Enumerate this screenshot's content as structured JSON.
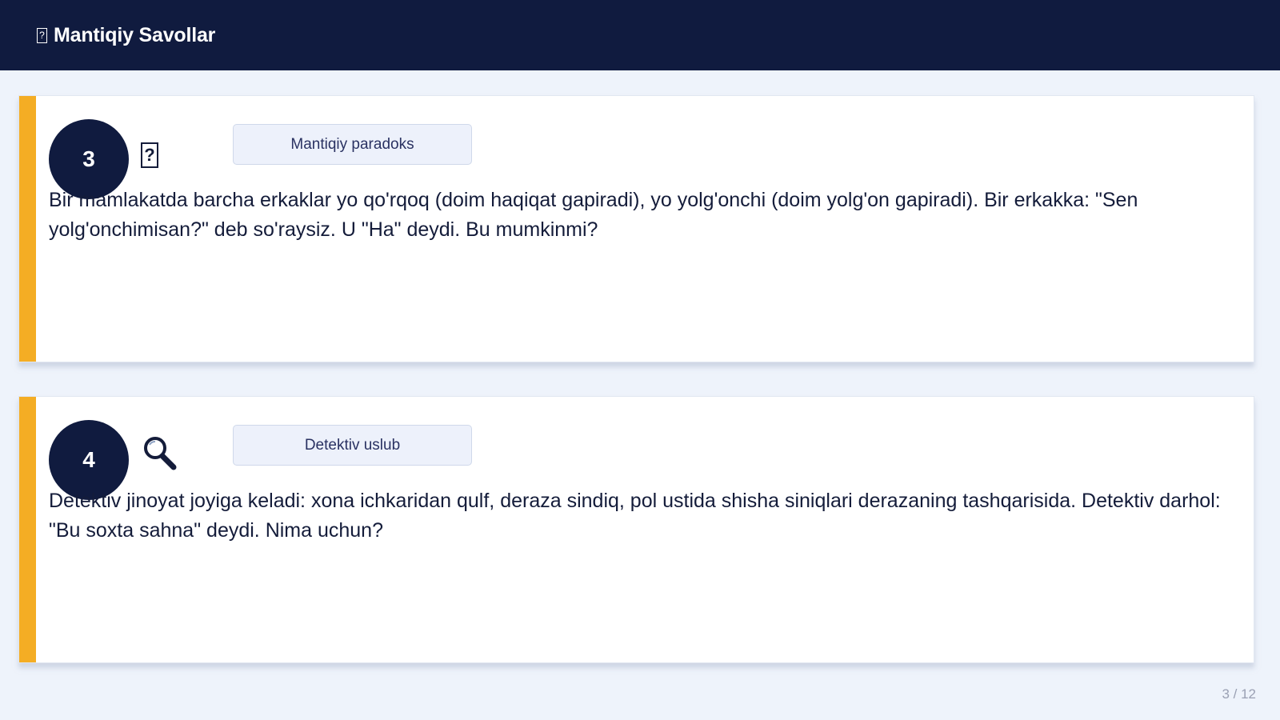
{
  "header": {
    "icon": "question-box-icon",
    "title": "Mantiqiy Savollar"
  },
  "cards": [
    {
      "number": "3",
      "icon": "question-box-icon",
      "tag": "Mantiqiy paradoks",
      "text": "Bir mamlakatda barcha erkaklar yo qo'rqoq (doim haqiqat gapiradi), yo yolg'onchi (doim yolg'on gapiradi). Bir erkakka: \"Sen yolg'onchimisan?\" deb so'raysiz. U \"Ha\" deydi. Bu mumkinmi?"
    },
    {
      "number": "4",
      "icon": "magnifier-icon",
      "tag": "Detektiv uslub",
      "text": "Detektiv jinoyat joyiga keladi: xona ichkaridan qulf, deraza sindiq, pol ustida shisha siniqlari derazaning tashqarisida. Detektiv darhol: \"Bu soxta sahna\" deydi. Nima uchun?"
    }
  ],
  "pager": "3 / 12",
  "colors": {
    "header_bg": "#101b3f",
    "accent": "#f4ad24",
    "badge": "#101b3f",
    "background": "#eef3fb"
  }
}
